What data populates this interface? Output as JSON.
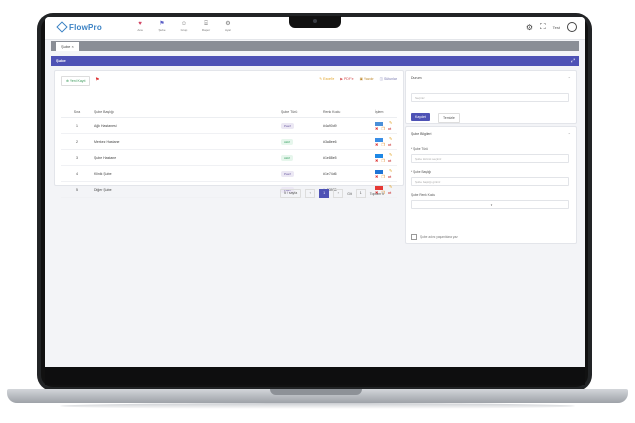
{
  "app": {
    "logo": "FlowPro"
  },
  "nav": [
    {
      "icon": "heart-icon",
      "label": "Ana"
    },
    {
      "icon": "flag-icon",
      "label": "Şube"
    },
    {
      "icon": "users-icon",
      "label": "Grup"
    },
    {
      "icon": "chart-icon",
      "label": "Rapor"
    },
    {
      "icon": "settings-icon",
      "label": "Ayar"
    }
  ],
  "user": {
    "name": "Test"
  },
  "tabs": [
    {
      "label": "Şube ×"
    }
  ],
  "section": {
    "title": "Şube"
  },
  "list": {
    "new_button": "Yeni Kayıt",
    "toolbar": {
      "a": "Excel'e",
      "b": "PDF'e",
      "c": "Yazdır",
      "d": "Sütunlar"
    },
    "columns": {
      "sira": "Sıra",
      "name": "Şube Başlığı",
      "durum": "Şube Türü",
      "kod": "Renk Kodu",
      "islem": "İşlem"
    },
    "rows": [
      {
        "sira": "1",
        "name": "Ağlı Hastanesi",
        "durum": "Pasif",
        "kod": "#4a90d9",
        "color": "#4a90d9"
      },
      {
        "sira": "2",
        "name": "Merkez Hastane",
        "durum": "Aktif",
        "kod": "#3a8ee6",
        "color": "#3a8ee6"
      },
      {
        "sira": "3",
        "name": "Şube Hastane",
        "durum": "Aktif",
        "kod": "#1e88e5",
        "color": "#1e88e5"
      },
      {
        "sira": "4",
        "name": "Klinik Şube",
        "durum": "Pasif",
        "kod": "#1e74d6",
        "color": "#1e74d6"
      },
      {
        "sira": "5",
        "name": "Diğer Şube",
        "durum": "Pasif",
        "kod": "#e53935",
        "color": "#e53935"
      }
    ],
    "pager": {
      "size": "5 / sayfa",
      "prev": "‹",
      "page": "1",
      "next": "›",
      "goto": "Git",
      "goto_val": "1",
      "total": "Toplam 5"
    }
  },
  "right": {
    "filter": {
      "title": "Durum",
      "placeholder": "Seçiniz",
      "save": "Kaydet",
      "clear": "Temizle"
    },
    "form": {
      "title": "Şube Bilgileri",
      "type_label": "* Şube Türü",
      "type_placeholder": "Şube türünü seçiniz",
      "name_label": "* Şube Başlığı",
      "name_placeholder": "Şube başlığı giriniz",
      "color_label": "Şube Renk Kodu",
      "check_label": "Şube adını yaşantılara yaz"
    }
  }
}
